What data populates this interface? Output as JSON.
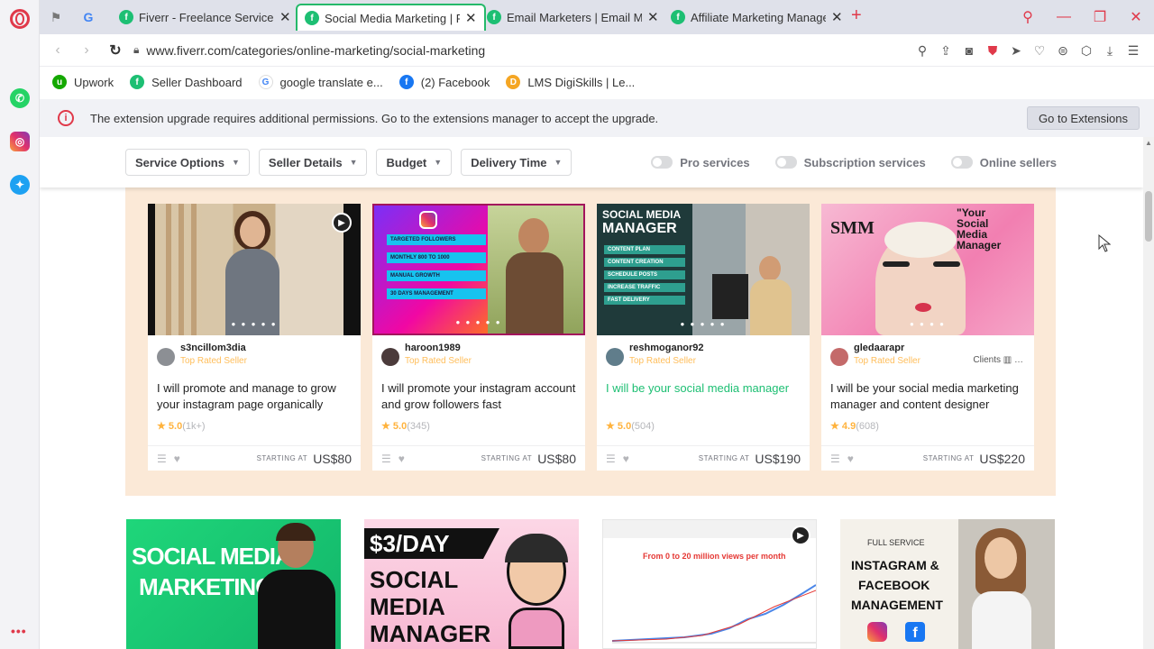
{
  "browser": {
    "tabs": [
      {
        "label": "Fiverr - Freelance Services",
        "active": false
      },
      {
        "label": "Social Media Marketing | Fiverr",
        "active": true
      },
      {
        "label": "Email Marketers | Email Marketing",
        "active": false
      },
      {
        "label": "Affiliate Marketing Managers",
        "active": false
      }
    ],
    "url": "www.fiverr.com/categories/online-marketing/social-marketing",
    "bookmarks": [
      {
        "label": "Upwork",
        "color": "#14a800"
      },
      {
        "label": "Seller Dashboard",
        "color": "#1dbf73"
      },
      {
        "label": "google translate e...",
        "color": "#4285f4"
      },
      {
        "label": "(2) Facebook",
        "color": "#1877f2"
      },
      {
        "label": "LMS DigiSkills | Le...",
        "color": "#f5a623"
      }
    ],
    "notification": {
      "text": "The extension upgrade requires additional permissions. Go to the extensions manager to accept the upgrade.",
      "button": "Go to Extensions"
    }
  },
  "filters": {
    "dropdowns": [
      "Service Options",
      "Seller Details",
      "Budget",
      "Delivery Time"
    ],
    "toggles": [
      "Pro services",
      "Subscription services",
      "Online sellers"
    ]
  },
  "featured_gigs": [
    {
      "seller": "s3ncillom3dia",
      "level": "Top Rated Seller",
      "title": "I will promote and manage to grow your instagram page organically",
      "rating": "5.0",
      "count": "(1k+)",
      "starting": "STARTING AT",
      "price": "US$80",
      "highlight": false,
      "clients": ""
    },
    {
      "seller": "haroon1989",
      "level": "Top Rated Seller",
      "title": "I will promote your instagram account and grow followers fast",
      "rating": "5.0",
      "count": "(345)",
      "starting": "STARTING AT",
      "price": "US$80",
      "highlight": false,
      "clients": ""
    },
    {
      "seller": "reshmoganor92",
      "level": "Top Rated Seller",
      "title": "I will be your social media manager",
      "rating": "5.0",
      "count": "(504)",
      "starting": "STARTING AT",
      "price": "US$190",
      "highlight": true,
      "clients": ""
    },
    {
      "seller": "gledaarapr",
      "level": "Top Rated Seller",
      "title": "I will be your social media marketing manager and content designer",
      "rating": "4.9",
      "count": "(608)",
      "starting": "STARTING AT",
      "price": "US$220",
      "highlight": false,
      "clients": "Clients"
    }
  ],
  "thumb_text": {
    "card2_lines": [
      "TARGETED FOLLOWERS",
      "MONTHLY 800 TO 1000",
      "MANUAL GROWTH",
      "30 DAYS MANAGEMENT"
    ],
    "card3_title": [
      "SOCIAL MEDIA",
      "MANAGER"
    ],
    "card3_lines": [
      "CONTENT PLAN",
      "CONTENT CREATION",
      "SCHEDULE POSTS",
      "INCREASE TRAFFIC",
      "FAST DELIVERY"
    ],
    "card4_big": "SMM",
    "card4_quote": [
      "\"Your",
      "Social",
      "Media",
      "Manager"
    ]
  },
  "row2": {
    "c1": [
      "SOCIAL MEDIA",
      "MARKETING"
    ],
    "c2_tag": "$3/DAY",
    "c2_lines": [
      "SOCIAL",
      "MEDIA",
      "MANAGER"
    ],
    "c3_caption": "From 0 to 20 million views per month",
    "c4_small": "FULL SERVICE",
    "c4_lines": [
      "INSTAGRAM &",
      "FACEBOOK",
      "MANAGEMENT"
    ]
  },
  "colors": {
    "fiverr_green": "#1dbf73",
    "opera_red": "#e0394a",
    "featured_bg": "#fbe9d7"
  }
}
